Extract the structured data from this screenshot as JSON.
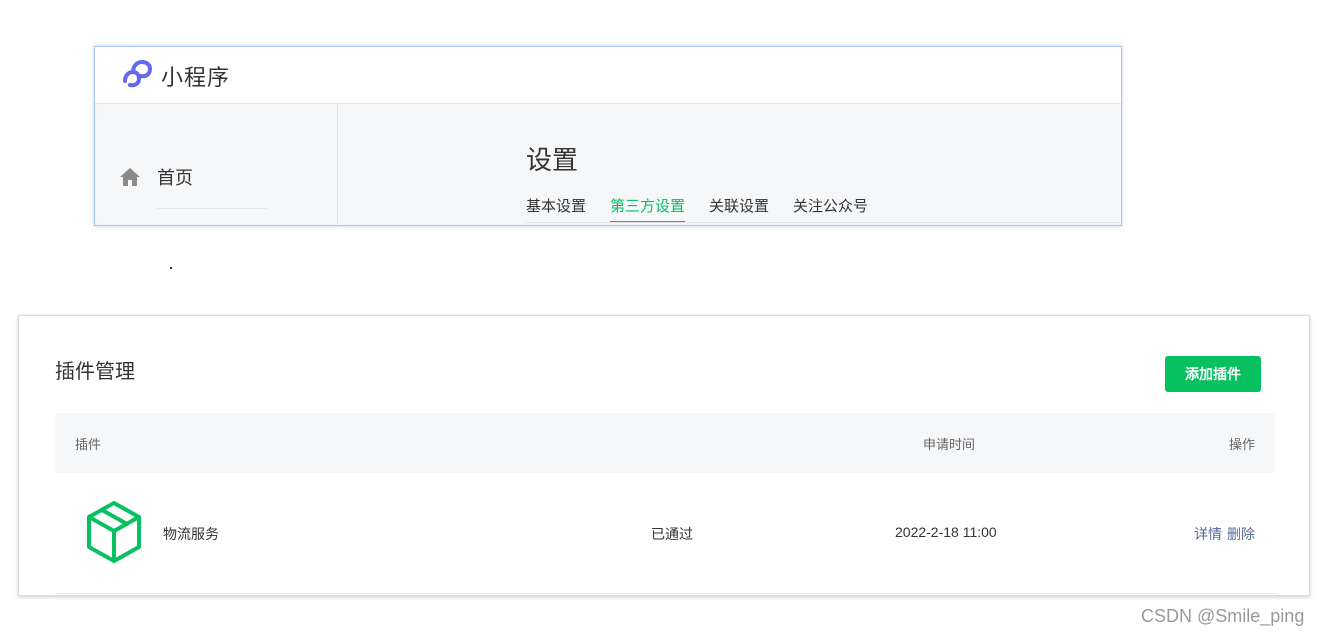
{
  "header": {
    "app_name": "小程序",
    "logo_icon": "miniprogram-logo-icon",
    "logo_color": "#6467f0"
  },
  "sidebar": {
    "items": [
      {
        "label": "首页",
        "icon": "home-icon"
      }
    ]
  },
  "settings": {
    "title": "设置",
    "tabs": [
      {
        "label": "基本设置",
        "active": false
      },
      {
        "label": "第三方设置",
        "active": true
      },
      {
        "label": "关联设置",
        "active": false
      },
      {
        "label": "关注公众号",
        "active": false
      }
    ]
  },
  "plugins": {
    "title": "插件管理",
    "add_label": "添加插件",
    "columns": {
      "plugin": "插件",
      "time": "申请时间",
      "action": "操作"
    },
    "rows": [
      {
        "icon": "package-box-icon",
        "name": "物流服务",
        "status": "已通过",
        "time": "2022-2-18 11:00",
        "detail_label": "详情",
        "delete_label": "删除"
      }
    ]
  },
  "watermark": "CSDN @Smile_ping",
  "colors": {
    "accent": "#07c160",
    "link": "#576b95",
    "panel_border": "#a9c7f5"
  }
}
